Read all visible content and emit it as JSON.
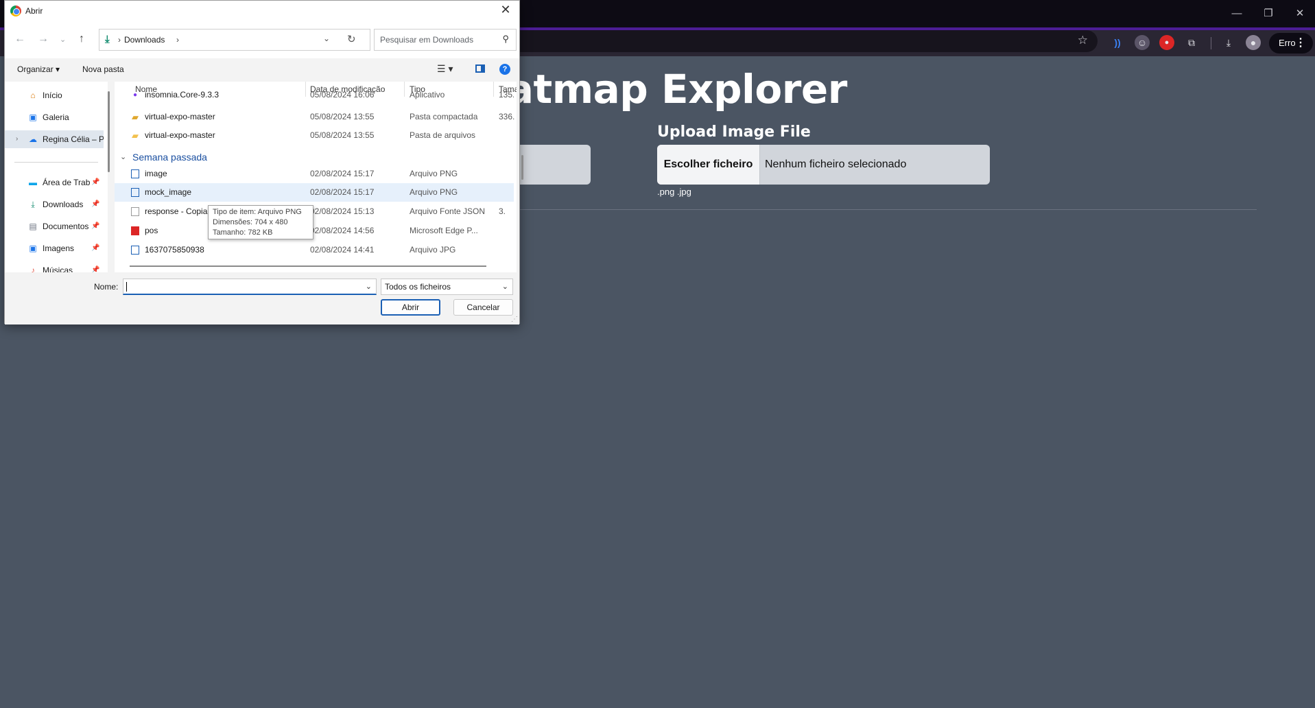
{
  "page": {
    "title_visible": "eatmap Explorer",
    "upload_label": "Upload Image File",
    "file_button": "Escolher ficheiro",
    "file_status": "Nenhum ficheiro selecionado",
    "accepted_hint": ".png .jpg"
  },
  "browser": {
    "profile_label": "Erro",
    "menu_glyph": "⋮"
  },
  "dialog": {
    "title": "Abrir",
    "breadcrumb": "Downloads",
    "search_placeholder": "Pesquisar em Downloads",
    "commands": {
      "organize": "Organizar",
      "new_folder": "Nova pasta"
    },
    "nav_items": [
      {
        "label": "Início",
        "icon": "home-icon"
      },
      {
        "label": "Galeria",
        "icon": "gallery-icon"
      },
      {
        "label": "Regina Célia – P",
        "icon": "onedrive-icon"
      },
      {
        "label": "Área de Trab",
        "icon": "desktop-icon"
      },
      {
        "label": "Downloads",
        "icon": "download-icon"
      },
      {
        "label": "Documentos",
        "icon": "documents-icon"
      },
      {
        "label": "Imagens",
        "icon": "pictures-icon"
      },
      {
        "label": "Músicas",
        "icon": "music-icon"
      }
    ],
    "columns": {
      "name": "Nome",
      "date": "Data de modificação",
      "type": "Tipo",
      "size": "Tamar"
    },
    "rows_top": [
      {
        "name": "insomnia.Core-9.3.3",
        "date": "05/08/2024 16:06",
        "type": "Aplicativo",
        "size": "135."
      },
      {
        "name": "virtual-expo-master",
        "date": "05/08/2024 13:55",
        "type": "Pasta compactada",
        "size": "336."
      },
      {
        "name": "virtual-expo-master",
        "date": "05/08/2024 13:55",
        "type": "Pasta de arquivos",
        "size": ""
      }
    ],
    "group_label": "Semana passada",
    "rows_group": [
      {
        "name": "image",
        "date": "02/08/2024 15:17",
        "type": "Arquivo PNG",
        "size": ""
      },
      {
        "name": "mock_image",
        "date": "02/08/2024 15:17",
        "type": "Arquivo PNG",
        "size": ""
      },
      {
        "name": "response - Copia",
        "date": "02/08/2024 15:13",
        "type": "Arquivo Fonte JSON",
        "size": "3."
      },
      {
        "name": "pos",
        "date": "02/08/2024 14:56",
        "type": "Microsoft Edge P...",
        "size": ""
      },
      {
        "name": "1637075850938",
        "date": "02/08/2024 14:41",
        "type": "Arquivo JPG",
        "size": ""
      }
    ],
    "tooltip": {
      "line1": "Tipo de item: Arquivo PNG",
      "line2": "Dimensões: 704 x 480",
      "line3": "Tamanho: 782 KB"
    },
    "name_label": "Nome:",
    "name_value": "",
    "type_filter": "Todos os ficheiros",
    "open_button": "Abrir",
    "cancel_button": "Cancelar"
  }
}
